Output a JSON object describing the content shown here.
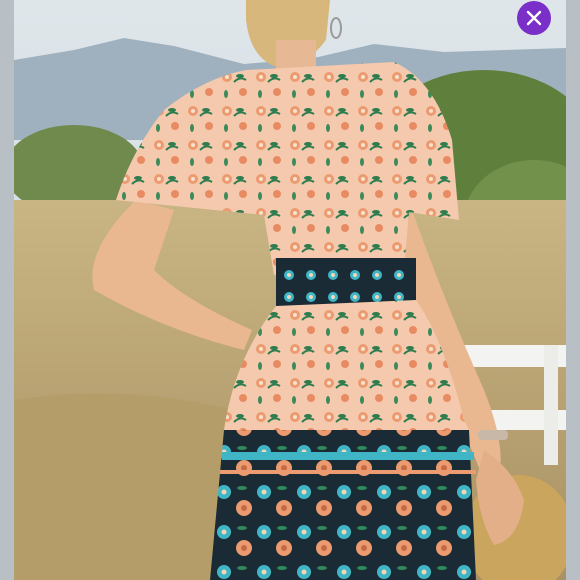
{
  "viewer": {
    "photo_subject": "",
    "close_icon": "close-icon",
    "accent_color": "#7b2fc9",
    "dress_colors": {
      "bodice": "#f4c9ad",
      "floral_accent": "#2f7d4f",
      "waist_band": "#1a2b35",
      "border_teal": "#3fb5c6",
      "border_orange": "#ec9a6f"
    }
  }
}
